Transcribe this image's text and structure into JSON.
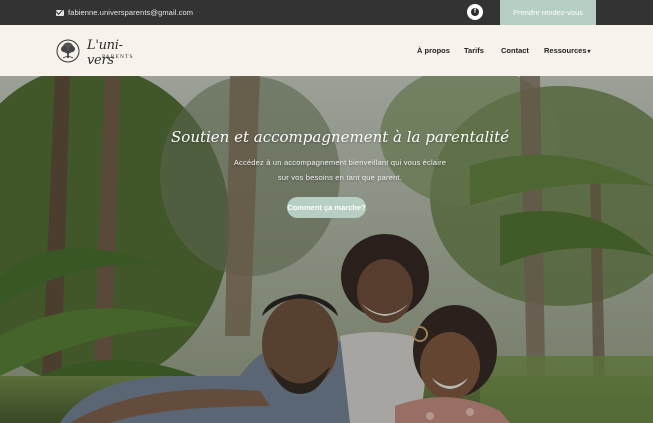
{
  "topbar": {
    "email": "fabienne.universparents@gmail.com",
    "cta_label": "Prendre rendez-vous"
  },
  "header": {
    "logo": {
      "script": "L'uni-vers",
      "sub": "PARENTS"
    },
    "nav": [
      {
        "label": "À propos"
      },
      {
        "label": "Tarifs"
      },
      {
        "label": "Contact"
      },
      {
        "label": "Ressources"
      }
    ]
  },
  "hero": {
    "title": "Soutien et accompagnement à la parentalité",
    "subtitle_line1": "Accédez à un accompagnement bienveillant qui vous éclaire",
    "subtitle_line2": "sur vos besoins en tant que parent.",
    "cta_label": "Comment ça marche?"
  },
  "colors": {
    "accent": "#b7cfc3",
    "topbar_bg": "#333333",
    "header_bg": "#f7f3ec"
  }
}
